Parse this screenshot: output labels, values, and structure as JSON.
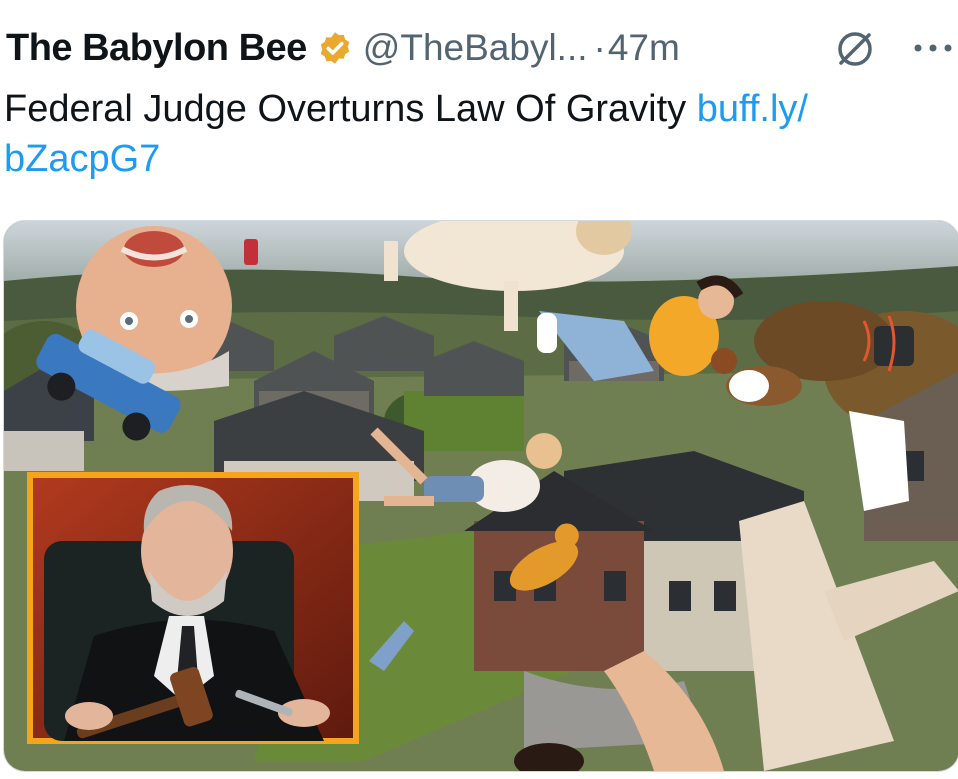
{
  "tweet": {
    "author_name": "The Babylon Bee",
    "handle": "@TheBabyl...",
    "separator": "·",
    "time": "47m",
    "text": "Federal Judge Overturns Law Of Gravity ",
    "link_part1": "buff.ly/",
    "link_part2": "bZacpG7"
  },
  "icons": {
    "verified": "verified-badge-icon",
    "muted": "muted-notification-icon",
    "more": "more-options-icon"
  },
  "colors": {
    "text": "#0f1419",
    "secondary": "#536471",
    "link": "#1d9bf0",
    "badge": "#e8a92e",
    "inset_border": "#f4a51c"
  }
}
